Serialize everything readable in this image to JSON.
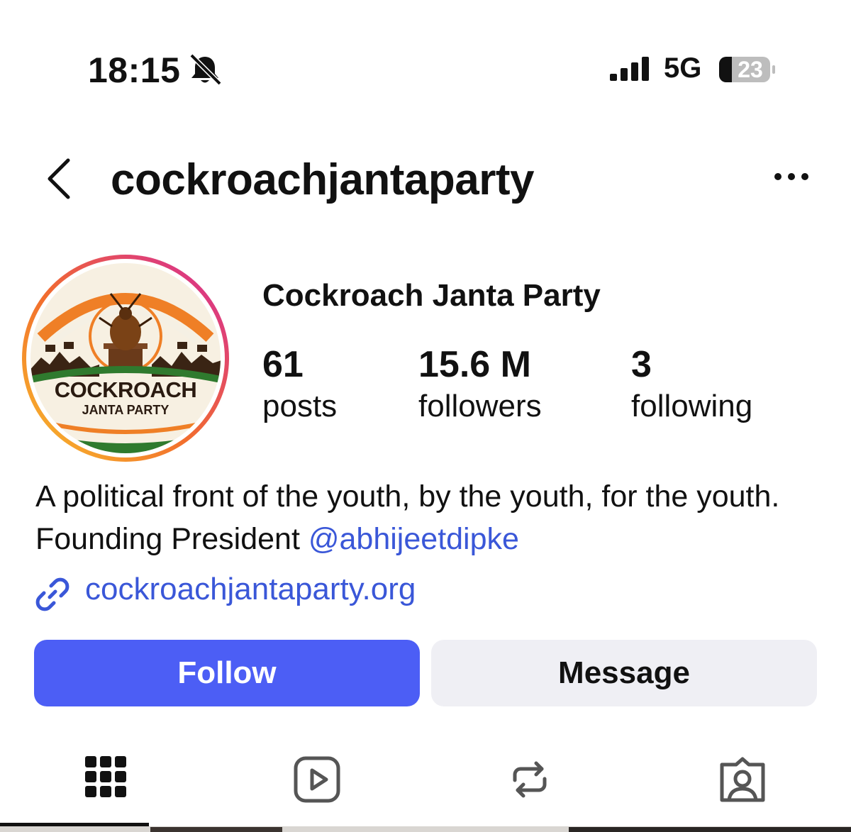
{
  "status_bar": {
    "time": "18:15",
    "network": "5G",
    "battery": "23",
    "icons": [
      "bell-slash-icon",
      "signal-icon",
      "battery-icon"
    ]
  },
  "header": {
    "username": "cockroachjantaparty",
    "icons": [
      "chevron-left-icon",
      "more-horizontal-icon"
    ]
  },
  "profile": {
    "display_name": "Cockroach Janta Party",
    "avatar_logo_text": [
      "COCKROACH",
      "JANTA PARTY"
    ],
    "stats": [
      {
        "value": "61",
        "label": "posts"
      },
      {
        "value": "15.6 M",
        "label": "followers"
      },
      {
        "value": "3",
        "label": "following"
      }
    ],
    "bio_text": "A political front of the youth, by the youth, for the youth. Founding President ",
    "bio_mention": "@abhijeetdipke",
    "link": "cockroachjantaparty.org"
  },
  "actions": {
    "follow_label": "Follow",
    "message_label": "Message"
  },
  "tabs": [
    {
      "icon": "grid-icon",
      "selected": true
    },
    {
      "icon": "reels-icon",
      "selected": false
    },
    {
      "icon": "reposts-icon",
      "selected": false
    },
    {
      "icon": "tagged-icon",
      "selected": false
    }
  ],
  "colors": {
    "accent_blue": "#4c5ef5",
    "link_blue": "#3a57d8",
    "secondary_button": "#efeff4",
    "story_ring_start": "#f6b42a",
    "story_ring_end": "#d62a9b"
  }
}
